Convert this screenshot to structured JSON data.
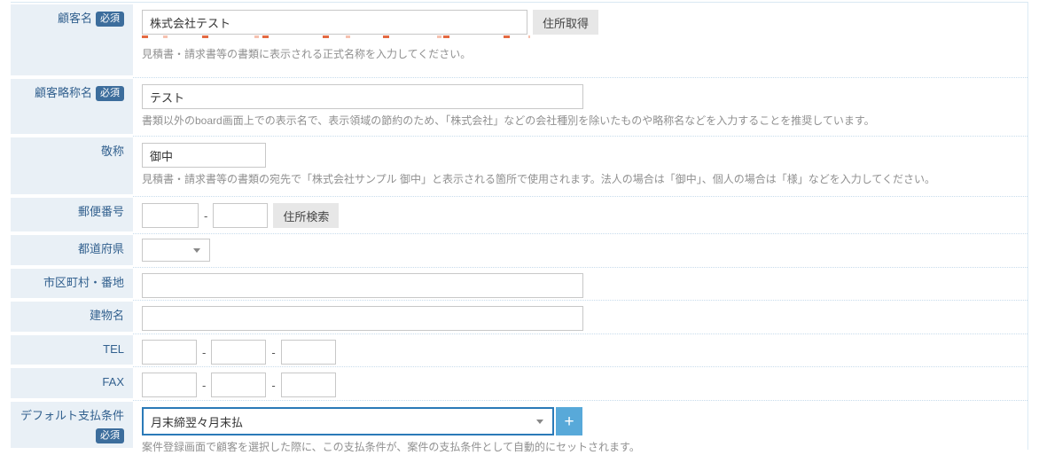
{
  "labels": {
    "required": "必須",
    "dash": "-",
    "add": "+"
  },
  "colors": {
    "accent_blue": "#2b7ab8",
    "add_button_blue": "#58a9d9",
    "badge_blue": "#3c6d9c",
    "label_text": "#33618f",
    "label_cell_bg": "#e9f0f6",
    "helper_text": "#909090",
    "dotted_separator": "#c8dcec",
    "button_gray": "#e7e7e7"
  },
  "form": {
    "rows": [
      {
        "label": "顧客名",
        "required": true,
        "value": "株式会社テスト",
        "button_label": "住所取得",
        "help": "見積書・請求書等の書類に表示される正式名称を入力してください。"
      },
      {
        "label": "顧客略称名",
        "required": true,
        "value": "テスト",
        "help": "書類以外のboard画面上での表示名で、表示領域の節約のため、「株式会社」などの会社種別を除いたものや略称名などを入力することを推奨しています。"
      },
      {
        "label": "敬称",
        "required": false,
        "value": "御中",
        "help": "見積書・請求書等の書類の宛先で「株式会社サンプル 御中」と表示される箇所で使用されます。法人の場合は「御中」、個人の場合は「様」などを入力してください。"
      },
      {
        "label": "郵便番号",
        "required": false,
        "value1": "",
        "value2": "",
        "button_label": "住所検索"
      },
      {
        "label": "都道府県",
        "required": false,
        "selected": ""
      },
      {
        "label": "市区町村・番地",
        "required": false,
        "value": ""
      },
      {
        "label": "建物名",
        "required": false,
        "value": ""
      },
      {
        "label": "TEL",
        "required": false,
        "value1": "",
        "value2": "",
        "value3": ""
      },
      {
        "label": "FAX",
        "required": false,
        "value1": "",
        "value2": "",
        "value3": ""
      },
      {
        "label": "デフォルト支払条件",
        "required": true,
        "selected": "月末締翌々月末払",
        "help": "案件登録画面で顧客を選択した際に、この支払条件が、案件の支払条件として自動的にセットされます。"
      }
    ]
  }
}
